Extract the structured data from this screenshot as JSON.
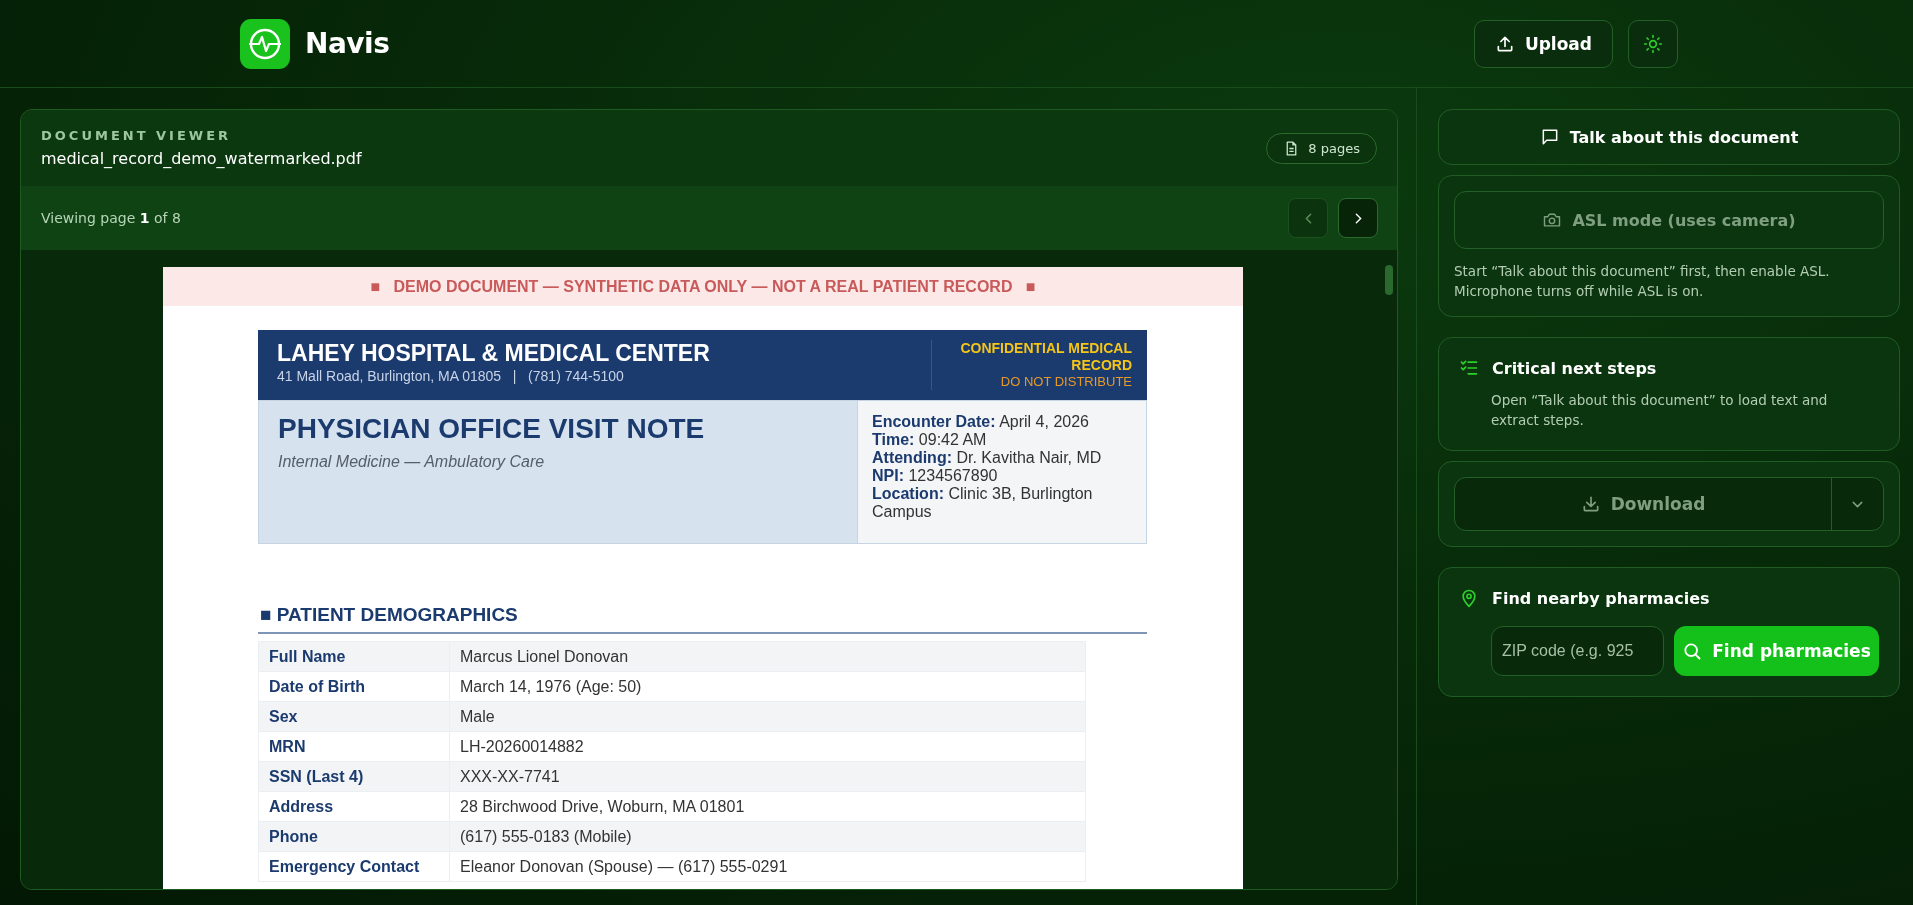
{
  "app": {
    "name": "Navis"
  },
  "header": {
    "upload": "Upload"
  },
  "viewer": {
    "label": "DOCUMENT VIEWER",
    "filename": "medical_record_demo_watermarked.pdf",
    "pages_badge": "8 pages",
    "page_status": "Viewing page **1** of 8",
    "prev": {
      "disabled": true
    },
    "next": {
      "disabled": false
    }
  },
  "document": {
    "banner": "■   DEMO DOCUMENT — SYNTHETIC DATA ONLY — NOT A REAL PATIENT RECORD   ■",
    "hospital": "LAHEY HOSPITAL & MEDICAL CENTER",
    "address": "41 Mall Road, Burlington, MA 01805   |   (781) 744-5100",
    "confidential": "CONFIDENTIAL MEDICAL RECORD",
    "distribution": "DO NOT DISTRIBUTE",
    "title": "PHYSICIAN OFFICE VISIT NOTE",
    "subtitle": "Internal Medicine — Ambulatory Care",
    "encounter": [
      {
        "label": "Encounter Date:",
        "value": "April 4, 2026"
      },
      {
        "label": "Time:",
        "value": "09:42 AM"
      },
      {
        "label": "Attending:",
        "value": "Dr. Kavitha Nair, MD"
      },
      {
        "label": "NPI:",
        "value": "1234567890"
      },
      {
        "label": "Location:",
        "value": "Clinic 3B, Burlington Campus"
      }
    ],
    "section": "■ PATIENT DEMOGRAPHICS",
    "rows": [
      {
        "label": "Full Name",
        "value": "Marcus Lionel Donovan"
      },
      {
        "label": "Date of Birth",
        "value": "March 14, 1976 (Age: 50)"
      },
      {
        "label": "Sex",
        "value": "Male"
      },
      {
        "label": "MRN",
        "value": "LH-20260014882"
      },
      {
        "label": "SSN (Last 4)",
        "value": "XXX-XX-7741"
      },
      {
        "label": "Address",
        "value": "28 Birchwood Drive, Woburn, MA 01801"
      },
      {
        "label": "Phone",
        "value": "(617) 555-0183 (Mobile)"
      },
      {
        "label": "Emergency Contact",
        "value": "Eleanor Donovan (Spouse) — (617) 555-0291"
      }
    ]
  },
  "sidebar": {
    "talk": "Talk about this document",
    "asl": {
      "label": "ASL mode (uses camera)",
      "disabled": true,
      "note": "Start “Talk about this document” first, then enable ASL. Microphone turns off while ASL is on."
    },
    "steps": {
      "title": "Critical next steps",
      "text": "Open “Talk about this document” to load text and extract steps."
    },
    "download": {
      "label": "Download",
      "disabled": true
    },
    "pharmacies": {
      "title": "Find nearby pharmacies",
      "placeholder": "ZIP code (e.g. 925",
      "button": "Find pharmacies"
    }
  }
}
